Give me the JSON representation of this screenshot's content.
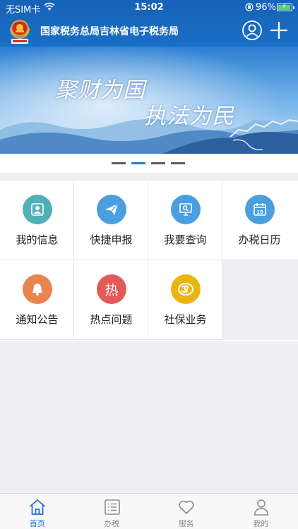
{
  "status_bar": {
    "carrier": "无SIM卡",
    "time": "15:02",
    "battery": "96%"
  },
  "nav": {
    "title": "国家税务总局吉林省电子税务局"
  },
  "banner": {
    "line1": "聚财为国",
    "line2": "执法为民",
    "page_count": 4,
    "active_index": 1
  },
  "menu": [
    {
      "label": "我的信息",
      "icon": "user-icon",
      "color": "#4fb0b5"
    },
    {
      "label": "快捷申报",
      "icon": "paper-plane-icon",
      "color": "#4a9fe0"
    },
    {
      "label": "我要查询",
      "icon": "search-monitor-icon",
      "color": "#4a9fe0"
    },
    {
      "label": "办税日历",
      "icon": "calendar-icon",
      "color": "#4a9fe0"
    },
    {
      "label": "通知公告",
      "icon": "bell-icon",
      "color": "#e8844f"
    },
    {
      "label": "热点问题",
      "icon": "hot-icon",
      "icon_text": "热",
      "color": "#e35a5a"
    },
    {
      "label": "社保业务",
      "icon": "social-security-icon",
      "color": "#ecb412"
    }
  ],
  "tabs": [
    {
      "label": "首页",
      "icon": "home-icon",
      "active": true
    },
    {
      "label": "办税",
      "icon": "list-icon",
      "active": false
    },
    {
      "label": "服务",
      "icon": "heart-icon",
      "active": false
    },
    {
      "label": "我的",
      "icon": "person-icon",
      "active": false
    }
  ],
  "colors": {
    "header": "#1a6ec5",
    "accent": "#1a73d6",
    "background": "#eeeef3"
  }
}
